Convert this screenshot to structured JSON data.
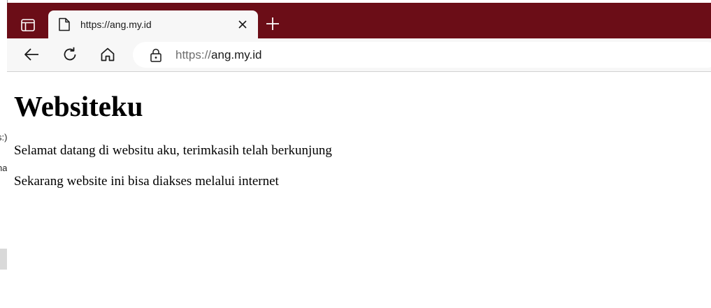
{
  "background_window": {
    "fragments": [
      "s:)",
      "na"
    ]
  },
  "browser": {
    "tab": {
      "title": "https://ang.my.id"
    },
    "toolbar": {
      "icons": [
        "back-arrow-icon",
        "refresh-icon",
        "home-icon"
      ]
    },
    "address_bar": {
      "scheme": "https://",
      "host": "ang.my.id"
    },
    "colors": {
      "tabstrip": "#6b0d17",
      "toolbar": "#f7f7f7",
      "address_bar": "#ffffff"
    }
  },
  "page": {
    "heading": "Websiteku",
    "paragraphs": [
      "Selamat datang di websitu aku, terimkasih telah berkunjung",
      "Sekarang website ini bisa diakses melalui internet"
    ]
  }
}
